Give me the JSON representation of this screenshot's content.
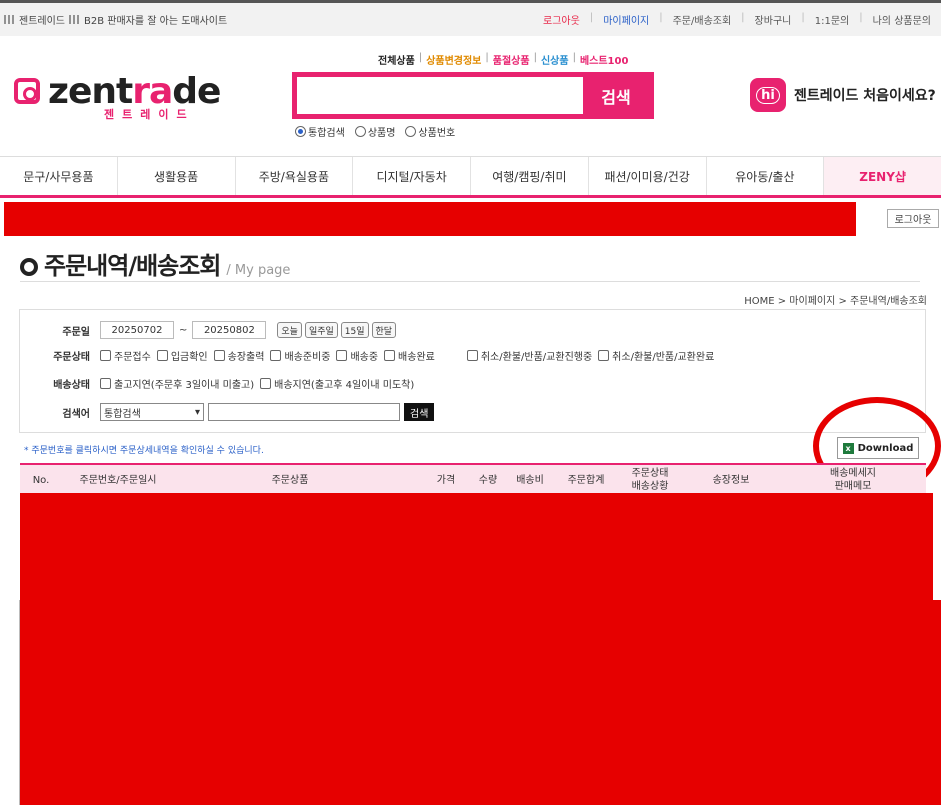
{
  "topbar": {
    "left_items": [
      "젠트레이드",
      "B2B 판매자를 잘 아는 도매사이트"
    ],
    "right_links": [
      {
        "label": "로그아웃",
        "color": "#e8294a"
      },
      {
        "label": "마이페이지",
        "color": "#2a60c8"
      },
      {
        "label": "주문/배송조회",
        "color": "#555555"
      },
      {
        "label": "장바구니",
        "color": "#555555"
      },
      {
        "label": "1:1문의",
        "color": "#555555"
      },
      {
        "label": "나의 상품문의",
        "color": "#555555"
      }
    ]
  },
  "logo": {
    "word_a": "zent",
    "word_b": "ra",
    "word_c": "de",
    "kor": "젠트레이드"
  },
  "quick_links": [
    "전체상품",
    "상품변경정보",
    "품절상품",
    "신상품",
    "베스트100"
  ],
  "search": {
    "value": "",
    "button": "검색",
    "options": [
      "통합검색",
      "상품명",
      "상품번호"
    ],
    "selected": "통합검색"
  },
  "welcome": {
    "badge": "hi",
    "text": "젠트레이드 처음이세요?"
  },
  "nav": [
    "문구/사무용품",
    "생활용품",
    "주방/욕실용품",
    "디지털/자동차",
    "여행/캠핑/취미",
    "패션/이미용/건강",
    "유아동/출산",
    "ZENY샵"
  ],
  "logout_button": "로그아웃",
  "page": {
    "title": "주문내역/배송조회",
    "subtitle": "/ My page",
    "breadcrumb": "HOME > 마이페이지 > 주문내역/배송조회"
  },
  "filter": {
    "order_date_label": "주문일",
    "date_from": "20250702",
    "date_to": "20250802",
    "period_buttons": [
      "오늘",
      "일주일",
      "15일",
      "한달"
    ],
    "order_status_label": "주문상태",
    "order_status_options": [
      "주문접수",
      "입금확인",
      "송장출력",
      "배송준비중",
      "배송중",
      "배송완료",
      "취소/환불/반품/교환진행중",
      "취소/환불/반품/교환완료"
    ],
    "delivery_status_label": "배송상태",
    "delivery_status_options": [
      "출고지연(주문후 3일이내 미출고)",
      "배송지연(출고후 4일이내 미도착)"
    ],
    "search_label": "검색어",
    "search_select": "통합검색",
    "search_value": "",
    "search_button": "검색"
  },
  "notice": "* 주문번호를 클릭하시면 주문상세내역을 확인하실 수 있습니다.",
  "download_button": "Download",
  "table_headers": [
    "No.",
    "주문번호/주문일시",
    "주문상품",
    "가격",
    "수량",
    "배송비",
    "주문합계",
    "주문상태\n배송상황",
    "송장정보",
    "배송메세지\n판매메모"
  ],
  "colors": {
    "brand": "#e8226f",
    "redaction": "#e60000"
  }
}
